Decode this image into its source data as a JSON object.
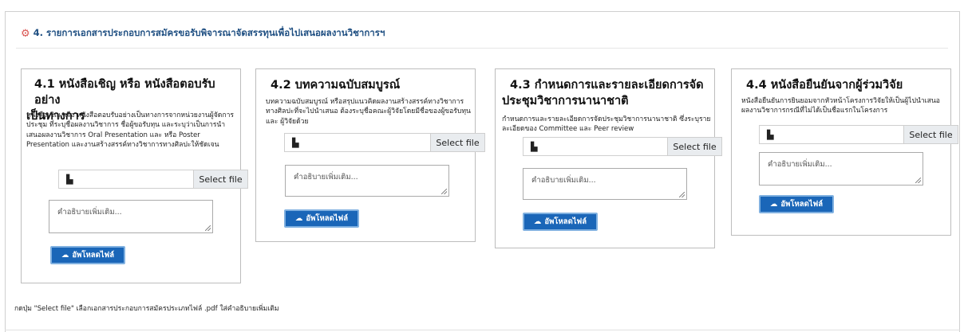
{
  "section": {
    "title": "4. รายการเอกสารประกอบการสมัครขอรับพิจารณาจัดสรรทุนเพื่อไปเสนอผลงานวิชาการฯ",
    "icon": "gear-icon",
    "accent": "#1f4f82",
    "icon_color": "#d9534f"
  },
  "cards": [
    {
      "title": "4.1 หนังสือเชิญ หรือ หนังสือตอบรับอย่างเป็นทางการ",
      "title_lines": [
        "4.1 หนังสือเชิญ หรือ หนังสือตอบรับอย่าง",
        "เป็นทางการ"
      ],
      "description": "หนังสือเชิญ หรือ หนังสือตอบรับอย่างเป็นทางการจากหน่วยงานผู้จัดการประชุม ที่ระบุชื่อผลงานวิชาการ ชื่อผู้ขอรับทุน และระบุว่าเป็นการนำเสนอผลงานวิชาการ Oral Presentation และ หรือ Poster Presentation และงานสร้างสรรค์ทางวิชาการทางศิลปะให้ชัดเจน",
      "file_button": "Select file",
      "textarea_placeholder": "คำอธิบายเพิ่มเติม...",
      "upload_button": "อัพโหลดไฟล์"
    },
    {
      "title": "4.2 บทความฉบับสมบูรณ์",
      "title_lines": [
        "4.2 บทความฉบับสมบูรณ์"
      ],
      "description": "บทความฉบับสมบูรณ์ หรือสรุปแนวคิดผลงานสร้างสรรค์ทางวิชาการทางศิลปะที่จะไปนำเสนอ ต้องระบุชื่อคณะผู้วิจัยโดยมีชื่อของผู้ขอรับทุนและ ผู้วิจัยด้วย",
      "file_button": "Select file",
      "textarea_placeholder": "คำอธิบายเพิ่มเติม...",
      "upload_button": "อัพโหลดไฟล์"
    },
    {
      "title": "4.3 กำหนดการและรายละเอียดการจัดประชุมวิชาการนานาชาติ",
      "title_lines": [
        "4.3 กำหนดการและรายละเอียดการจัด",
        "ประชุมวิชาการนานาชาติ"
      ],
      "description": "กำหนดการและรายละเอียดการจัดประชุมวิชาการนานาชาติ ซึ่งระบุรายละเอียดของ Committee และ Peer review",
      "file_button": "Select file",
      "textarea_placeholder": "คำอธิบายเพิ่มเติม...",
      "upload_button": "อัพโหลดไฟล์"
    },
    {
      "title": "4.4 หนังสือยืนยันจากผู้ร่วมวิจัย",
      "title_lines": [
        "4.4 หนังสือยืนยันจากผู้ร่วมวิจัย"
      ],
      "description": "หนังสือยืนยันการยินยอมจากหัวหน้าโครงการวิจัยให้เป็นผู้ไปนำเสนอผลงานวิชาการกรณีที่ไม่ได้เป็นชื่อแรกในโครงการ",
      "file_button": "Select file",
      "textarea_placeholder": "คำอธิบายเพิ่มเติม...",
      "upload_button": "อัพโหลดไฟล์"
    }
  ],
  "footnote": "กดปุ่ม \"Select file\" เลือกเอกสารประกอบการสมัครประเภทไฟล์ .pdf ใส่คำอธิบายเพิ่มเติม",
  "colors": {
    "upload_button": "#1a66b8",
    "select_button_bg": "#e9ecef"
  }
}
